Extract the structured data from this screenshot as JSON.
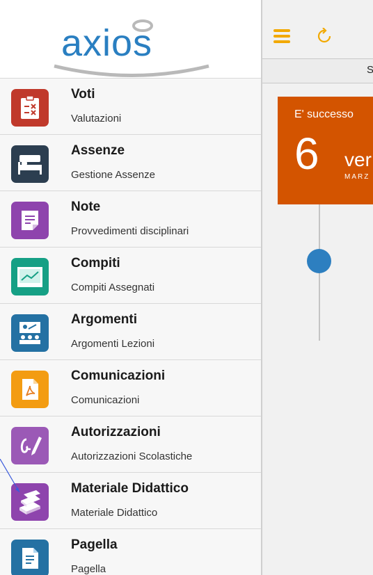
{
  "brand": {
    "logo_text": "axios"
  },
  "menu": [
    {
      "title": "Voti",
      "subtitle": "Valutazioni",
      "icon": "grades-icon",
      "color": "#c0392b"
    },
    {
      "title": "Assenze",
      "subtitle": "Gestione Assenze",
      "icon": "bed-icon",
      "color": "#2c3e50"
    },
    {
      "title": "Note",
      "subtitle": "Provvedimenti disciplinari",
      "icon": "note-icon",
      "color": "#8e44ad"
    },
    {
      "title": "Compiti",
      "subtitle": "Compiti Assegnati",
      "icon": "chart-board-icon",
      "color": "#16a085"
    },
    {
      "title": "Argomenti",
      "subtitle": "Argomenti Lezioni",
      "icon": "classroom-icon",
      "color": "#2471a3"
    },
    {
      "title": "Comunicazioni",
      "subtitle": "Comunicazioni",
      "icon": "pdf-icon",
      "color": "#f39c12"
    },
    {
      "title": "Autorizzazioni",
      "subtitle": "Autorizzazioni Scolastiche",
      "icon": "signature-icon",
      "color": "#9b59b6"
    },
    {
      "title": "Materiale Didattico",
      "subtitle": "Materiale Didattico",
      "icon": "books-icon",
      "color": "#8e44ad"
    },
    {
      "title": "Pagella",
      "subtitle": "Pagella",
      "icon": "report-card-icon",
      "color": "#2471a3"
    }
  ],
  "topbar": {
    "subbar_text": "S"
  },
  "event": {
    "heading": "E' successo",
    "day": "6",
    "weekday": "ver",
    "month": "MARZ"
  },
  "colors": {
    "accent": "#f2a900",
    "event": "#d35400",
    "timeline_dot": "#2d7fc0"
  }
}
